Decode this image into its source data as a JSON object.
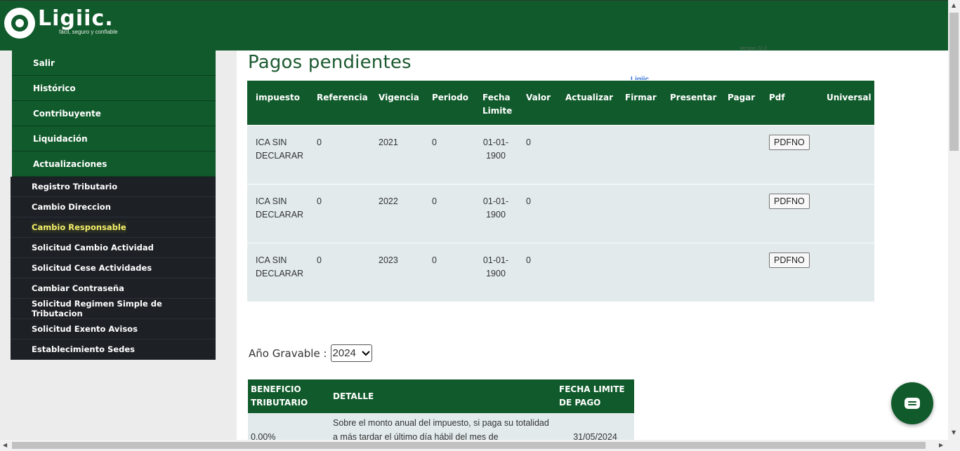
{
  "brand": {
    "name": "Ligiic.",
    "tagline": "fácil, seguro y confiable",
    "version": "Version 22.0"
  },
  "menu": {
    "items": [
      {
        "label": "Salir"
      },
      {
        "label": "Histórico"
      },
      {
        "label": "Contribuyente"
      },
      {
        "label": "Liquidación"
      },
      {
        "label": "Actualizaciones"
      }
    ],
    "subitems": [
      {
        "label": "Registro Tributario"
      },
      {
        "label": "Cambio Direccion"
      },
      {
        "label": "Cambio Responsable"
      },
      {
        "label": "Solicitud Cambio Actividad"
      },
      {
        "label": "Solicitud Cese Actividades"
      },
      {
        "label": "Cambiar Contraseña"
      },
      {
        "label": "Solicitud Regimen Simple de Tributacion"
      },
      {
        "label": "Solicitud Exento Avisos"
      },
      {
        "label": "Establecimiento Sedes"
      }
    ]
  },
  "main": {
    "title": "Pagos pendientes",
    "top_link": "Ligiic",
    "pending": {
      "headers": [
        "impuesto",
        "Referencia",
        "Vigencia",
        "Periodo",
        "Fecha Limite",
        "Valor",
        "Actualizar",
        "Firmar",
        "Presentar",
        "Pagar",
        "Pdf",
        "Universal"
      ],
      "rows": [
        {
          "impuesto": "ICA SIN DECLARAR",
          "referencia": "0",
          "vigencia": "2021",
          "periodo": "0",
          "fecha": "01-01-1900",
          "valor": "0",
          "pdf": "PDFNO"
        },
        {
          "impuesto": "ICA SIN DECLARAR",
          "referencia": "0",
          "vigencia": "2022",
          "periodo": "0",
          "fecha": "01-01-1900",
          "valor": "0",
          "pdf": "PDFNO"
        },
        {
          "impuesto": "ICA SIN DECLARAR",
          "referencia": "0",
          "vigencia": "2023",
          "periodo": "0",
          "fecha": "01-01-1900",
          "valor": "0",
          "pdf": "PDFNO"
        }
      ]
    },
    "year": {
      "label": "Año Gravable :",
      "selected": "2024"
    },
    "benefits": {
      "headers": [
        "BENEFICIO TRIBUTARIO",
        "DETALLE",
        "FECHA LIMITE DE PAGO"
      ],
      "rows": [
        {
          "beneficio": "0.00%",
          "detalle": "Sobre el monto anual del impuesto, si paga su totalidad a más tardar el último día hábil del mes de",
          "fecha": "31/05/2024"
        }
      ]
    }
  },
  "colors": {
    "primary": "#105a2b",
    "submenu_bg": "#1d2126",
    "active_text": "#f5f06a",
    "row_bg": "#e2eaeb"
  },
  "icons": {
    "chat": "chat-bubble-icon"
  }
}
